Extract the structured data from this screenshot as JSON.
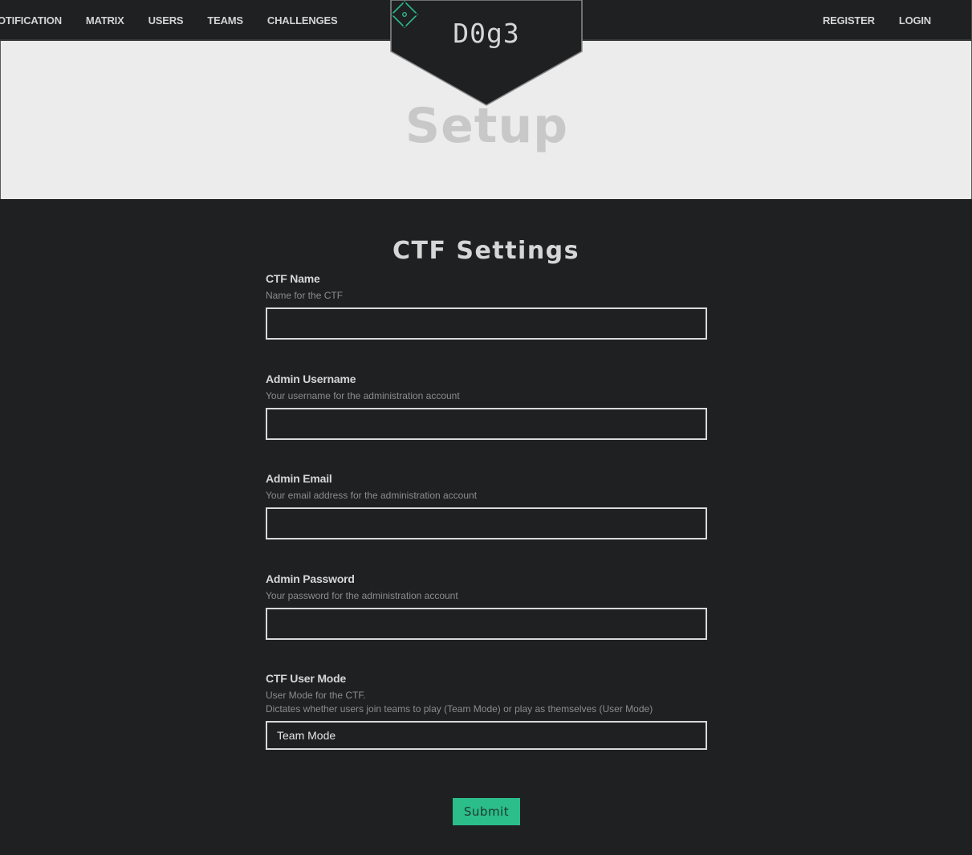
{
  "nav": {
    "left_items": [
      {
        "label": "OTIFICATION"
      },
      {
        "label": "MATRIX"
      },
      {
        "label": "USERS"
      },
      {
        "label": "TEAMS"
      },
      {
        "label": "CHALLENGES"
      }
    ],
    "right_items": [
      {
        "label": "REGISTER"
      },
      {
        "label": "LOGIN"
      }
    ]
  },
  "logo": {
    "text": "D0g3",
    "icon": "diamond-target-icon",
    "accent_color": "#2bbd8a"
  },
  "jumbotron": {
    "title": "Setup"
  },
  "form": {
    "title": "CTF Settings",
    "fields": [
      {
        "label": "CTF Name",
        "help": "Name for the CTF",
        "value": ""
      },
      {
        "label": "Admin Username",
        "help": "Your username for the administration account",
        "value": ""
      },
      {
        "label": "Admin Email",
        "help": "Your email address for the administration account",
        "value": ""
      },
      {
        "label": "Admin Password",
        "help": "Your password for the administration account",
        "value": ""
      }
    ],
    "user_mode": {
      "label": "CTF User Mode",
      "help_line1": "User Mode for the CTF.",
      "help_line2": "Dictates whether users join teams to play (Team Mode) or play as themselves (User Mode)",
      "selected": "Team Mode"
    },
    "submit_label": "Submit"
  },
  "colors": {
    "background": "#1f2022",
    "jumbotron": "#ececec",
    "accent": "#2bbd8a"
  }
}
